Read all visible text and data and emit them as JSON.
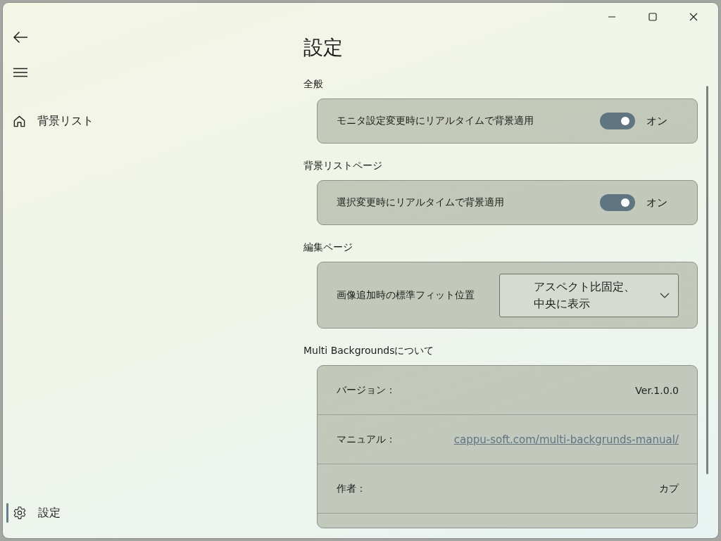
{
  "nav": {
    "items": [
      {
        "label": "背景リスト",
        "kind": "page",
        "selected": false
      },
      {
        "label": "設定",
        "kind": "settings",
        "selected": true
      }
    ]
  },
  "page": {
    "title": "設定"
  },
  "sections": [
    {
      "heading": "全般",
      "items": [
        {
          "kind": "toggle",
          "label": "モニタ設定変更時にリアルタイムで背景適用",
          "on": true,
          "state_text": "オン"
        }
      ]
    },
    {
      "heading": "背景リストページ",
      "items": [
        {
          "kind": "toggle",
          "label": "選択変更時にリアルタイムで背景適用",
          "on": true,
          "state_text": "オン"
        }
      ]
    },
    {
      "heading": "編集ページ",
      "items": [
        {
          "kind": "dropdown",
          "label": "画像追加時の標準フィット位置",
          "value": "アスペクト比固定、中央に表示"
        }
      ]
    },
    {
      "heading": "Multi Backgroundsについて",
      "items": [
        {
          "kind": "info",
          "label": "バージョン：",
          "value": "Ver.1.0.0"
        },
        {
          "kind": "link",
          "label": "マニュアル：",
          "value": "cappu-soft.com/multi-backgrunds-manual/"
        },
        {
          "kind": "info",
          "label": "作者：",
          "value": "カプ"
        }
      ]
    }
  ]
}
